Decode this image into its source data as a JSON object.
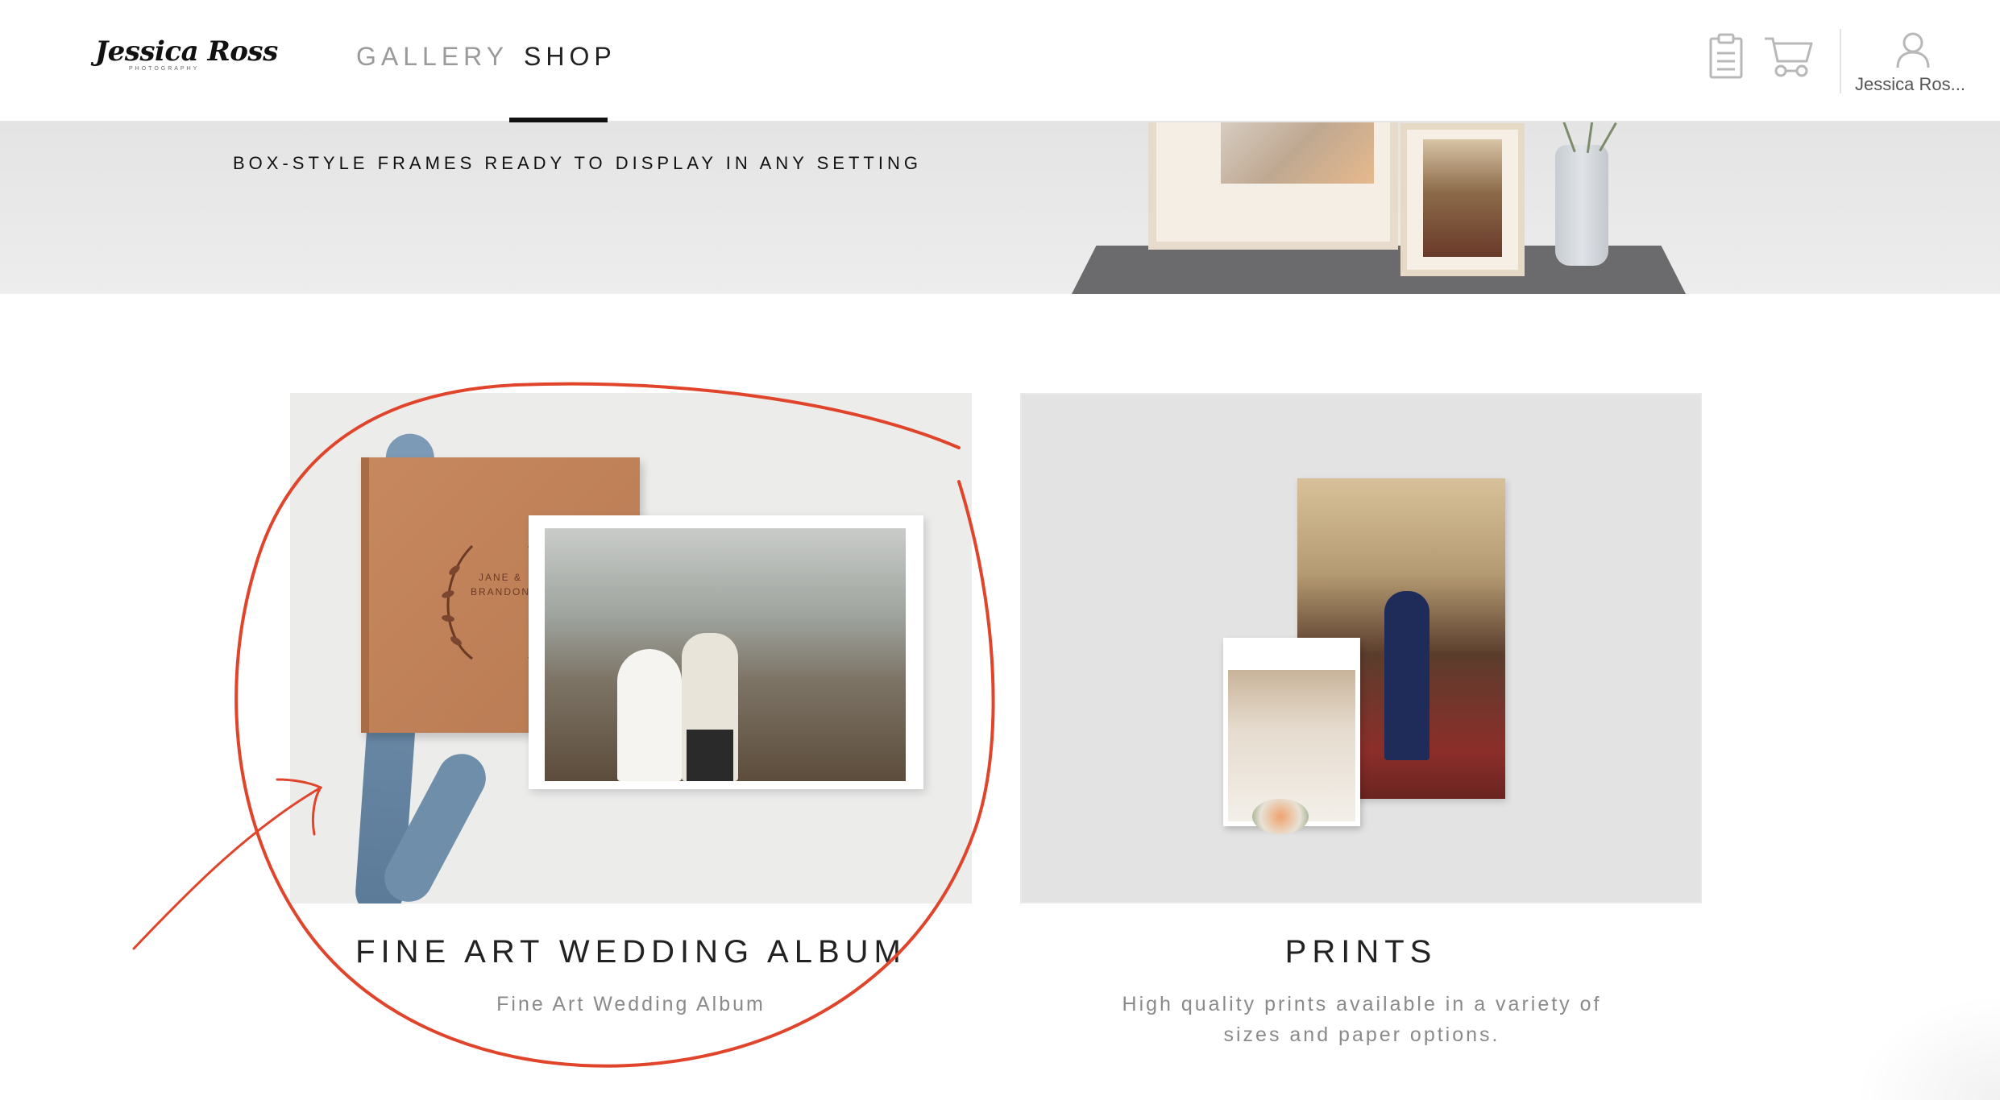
{
  "header": {
    "logo_text": "Jessica Ross",
    "logo_subtext": "PHOTOGRAPHY",
    "nav": [
      {
        "label": "GALLERY",
        "active": false
      },
      {
        "label": "SHOP",
        "active": true
      }
    ],
    "icons": [
      "clipboard-icon",
      "cart-icon",
      "user-icon"
    ],
    "account_label": "Jessica Ros..."
  },
  "banner": {
    "text": "BOX-STYLE FRAMES READY TO DISPLAY IN ANY SETTING"
  },
  "products": [
    {
      "title": "FINE ART WEDDING ALBUM",
      "description": "Fine Art Wedding Album",
      "album_cover_text": "JANE & BRANDON"
    },
    {
      "title": "PRINTS",
      "description": "High quality prints available in a variety of sizes and paper options."
    }
  ],
  "colors": {
    "annotation": "#e0452c",
    "nav_active": "#222222",
    "nav_inactive": "#9a9a9a",
    "album_cover": "#c7885f"
  }
}
